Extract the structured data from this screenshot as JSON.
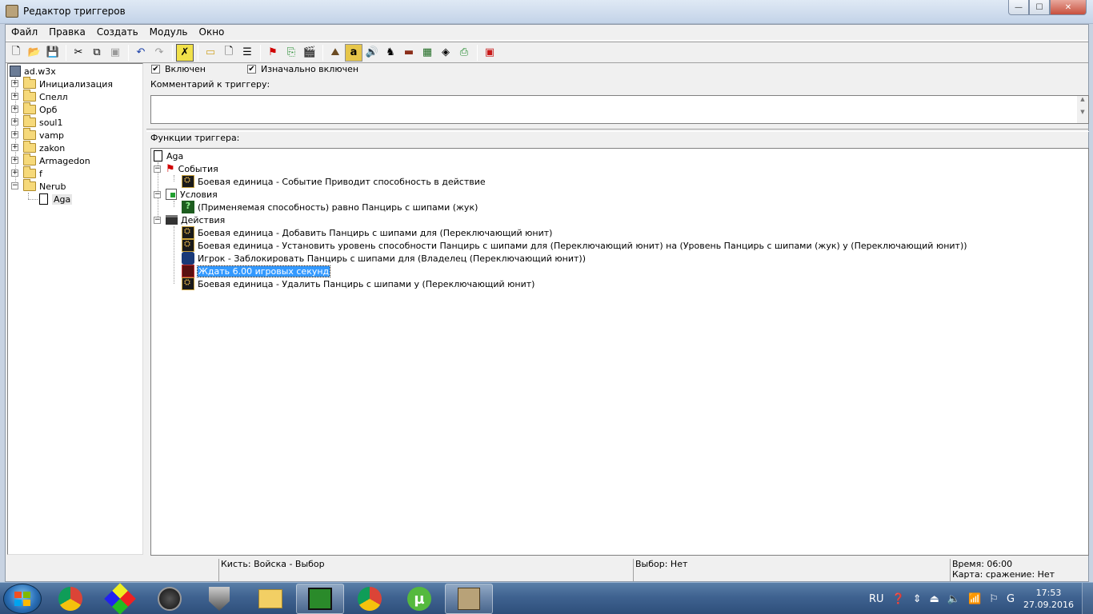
{
  "window": {
    "title": "Редактор триггеров",
    "min": "—",
    "max": "☐",
    "close": "✕"
  },
  "menu": [
    "Файл",
    "Правка",
    "Создать",
    "Модуль",
    "Окно"
  ],
  "toolbar": {
    "icons": [
      "new-icon",
      "open-icon",
      "save-icon",
      "cut-icon",
      "copy-icon",
      "paste-icon",
      "undo-icon",
      "redo-icon",
      "delete-icon",
      "new-category-icon",
      "new-trigger-icon",
      "new-comment-icon",
      "new-event-icon",
      "new-condition-icon",
      "new-action-icon",
      "terrain-icon",
      "text-icon",
      "sound-icon",
      "unit-icon",
      "doodad-icon",
      "object-icon",
      "ai-icon",
      "import-icon",
      "test-map-icon"
    ]
  },
  "left_tree": {
    "root": "ad.w3x",
    "folders": [
      "Инициализация",
      "Спелл",
      "Орб",
      "soul1",
      "vamp",
      "zakon",
      "Armagedon",
      "f",
      "Nerub"
    ],
    "selected_trigger": "Aga"
  },
  "trigger": {
    "enabled_label": "Включен",
    "initially_on_label": "Изначально включен",
    "comment_label": "Комментарий к триггеру:",
    "functions_label": "Функции триггера:",
    "name": "Aga",
    "events_label": "События",
    "events": [
      "Боевая единица - Событие Приводит способность в действие"
    ],
    "conditions_label": "Условия",
    "conditions": [
      "(Применяемая способность) равно Панцирь с шипами (жук)"
    ],
    "actions_label": "Действия",
    "actions": [
      "Боевая единица - Добавить Панцирь с шипами  для (Переключающий юнит)",
      "Боевая единица - Установить уровень способности Панцирь с шипами  для (Переключающий юнит) на (Уровень Панцирь с шипами (жук) у (Переключающий юнит))",
      "Игрок - Заблокировать Панцирь с шипами  для (Владелец (Переключающий юнит))",
      "Ждать 6.00 игровых секунд",
      "Боевая единица - Удалить Панцирь с шипами  у (Переключающий юнит)"
    ]
  },
  "status": {
    "brush": "Кисть: Войска - Выбор",
    "selection": "Выбор: Нет",
    "time": "Время: 06:00",
    "map": "Карта: сражение: Нет"
  },
  "taskbar": {
    "lang": "RU",
    "time": "17:53",
    "date": "27.09.2016"
  },
  "colors": {
    "selection": "#3399ff",
    "taskbar": "#3f6290"
  }
}
